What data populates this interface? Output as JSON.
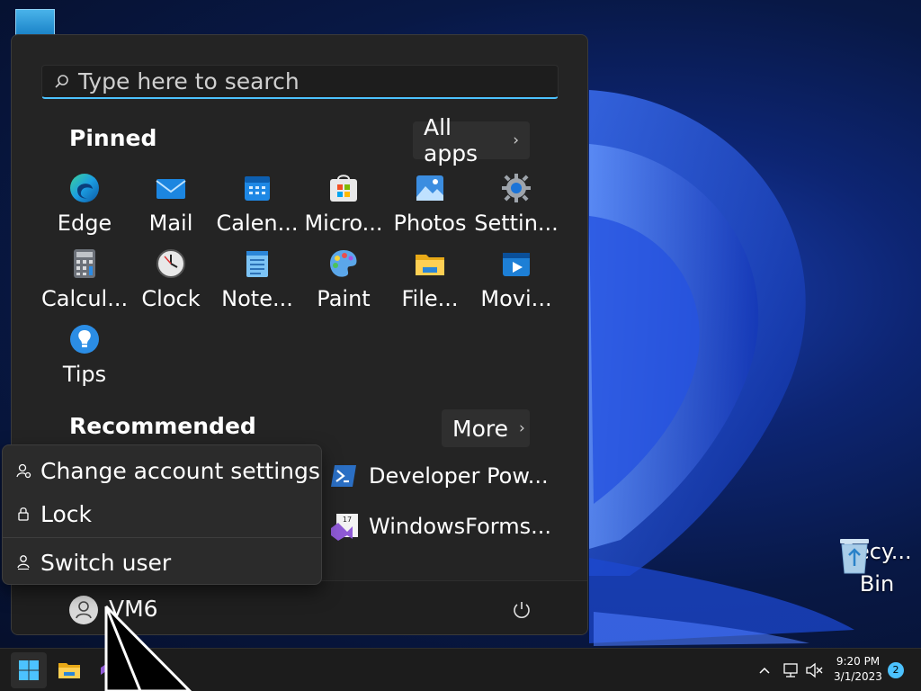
{
  "desktop": {
    "recycle_bin_label_line1": "Recy...",
    "recycle_bin_label_line2": "Bin"
  },
  "start_menu": {
    "search_placeholder": "Type here to search",
    "pinned_title": "Pinned",
    "all_apps_label": "All apps",
    "pinned_apps": [
      {
        "label": "Edge",
        "icon": "edge-icon"
      },
      {
        "label": "Mail",
        "icon": "mail-icon"
      },
      {
        "label": "Calen...",
        "icon": "calendar-icon"
      },
      {
        "label": "Micro...",
        "icon": "microsoft-store-icon"
      },
      {
        "label": "Photos",
        "icon": "photos-icon"
      },
      {
        "label": "Settin...",
        "icon": "settings-icon"
      },
      {
        "label": "Calcul...",
        "icon": "calculator-icon"
      },
      {
        "label": "Clock",
        "icon": "clock-icon"
      },
      {
        "label": "Note...",
        "icon": "notepad-icon"
      },
      {
        "label": "Paint",
        "icon": "paint-icon"
      },
      {
        "label": "File...",
        "icon": "file-explorer-icon"
      },
      {
        "label": "Movi...",
        "icon": "movies-icon"
      },
      {
        "label": "Tips",
        "icon": "tips-icon"
      }
    ],
    "recommended_title": "Recommended",
    "more_label": "More",
    "recommended_items": [
      {
        "label": "Developer Pow...",
        "icon": "powershell-icon"
      },
      {
        "label": "WindowsForms...",
        "icon": "visual-studio-icon",
        "badge": "17"
      }
    ],
    "user_name": "VM6"
  },
  "user_menu": {
    "items": [
      {
        "label": "Change account settings",
        "icon": "account-settings-icon"
      },
      {
        "label": "Lock",
        "icon": "lock-icon"
      },
      {
        "label": "Switch user",
        "icon": "switch-user-icon"
      }
    ]
  },
  "taskbar": {
    "time": "9:20 PM",
    "date": "3/1/2023",
    "notification_count": "2"
  },
  "colors": {
    "accent": "#4cc2ff",
    "menu_bg": "#242424",
    "taskbar_bg": "#1c1c1c"
  }
}
